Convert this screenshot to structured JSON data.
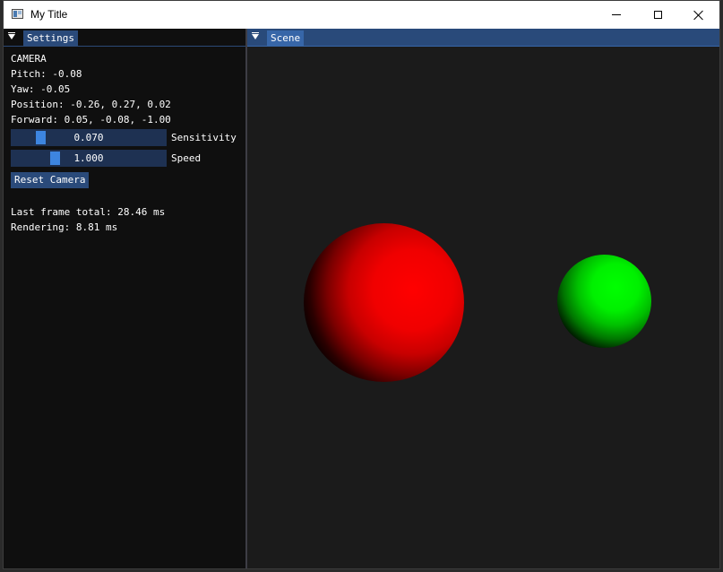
{
  "window": {
    "title": "My Title",
    "icon": "app-window-icon"
  },
  "settings": {
    "tab_label": "Settings",
    "camera_heading": "CAMERA",
    "pitch": "Pitch: -0.08",
    "yaw": "Yaw: -0.05",
    "position": "Position: -0.26, 0.27, 0.02",
    "forward": "Forward: 0.05, -0.08, -1.00",
    "sensitivity": {
      "value_text": "0.070",
      "label": "Sensitivity",
      "fraction": 0.17
    },
    "speed": {
      "value_text": "1.000",
      "label": "Speed",
      "fraction": 0.27
    },
    "reset_button": "Reset Camera",
    "frame_total": "Last frame total: 28.46 ms",
    "rendering": "Rendering: 8.81 ms"
  },
  "scene": {
    "tab_label": "Scene",
    "objects": [
      {
        "name": "red-sphere",
        "color": "#ff0000"
      },
      {
        "name": "green-sphere",
        "color": "#00ff00"
      }
    ]
  },
  "colors": {
    "accent": "#3d85e0",
    "frame_bg": "#1e3152",
    "button": "#2a4a7a",
    "scene_bg": "#1b1b1b",
    "panel_bg": "#0f0f0f"
  }
}
